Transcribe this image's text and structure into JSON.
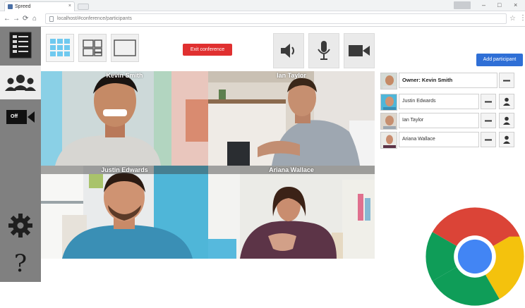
{
  "browser": {
    "tab_title": "Spreed",
    "tab_close": "×",
    "url": "localhost/#conference/participants",
    "star": "☆",
    "menu": "⋮",
    "back": "←",
    "forward": "→",
    "reload": "⟳",
    "home": "⌂",
    "minimize": "–",
    "maximize": "□",
    "close": "×"
  },
  "sidebar": {
    "off_label": "Off",
    "help_label": "?"
  },
  "toolbar": {
    "exit_label": "Exit conference",
    "add_participant_label": "Add participant"
  },
  "videos": [
    {
      "name": "Kevin Smith"
    },
    {
      "name": "Ian Taylor"
    },
    {
      "name": "Justin Edwards"
    },
    {
      "name": "Ariana Wallace"
    }
  ],
  "participants": {
    "owner": {
      "label": "Owner: Kevin Smith"
    },
    "items": [
      {
        "name": "Justin Edwards"
      },
      {
        "name": "Ian Taylor"
      },
      {
        "name": "Ariana Wallace"
      }
    ]
  },
  "colors": {
    "accent_blue": "#2f6fd6",
    "exit_red": "#e03030",
    "sidebar_gray": "#808080"
  }
}
